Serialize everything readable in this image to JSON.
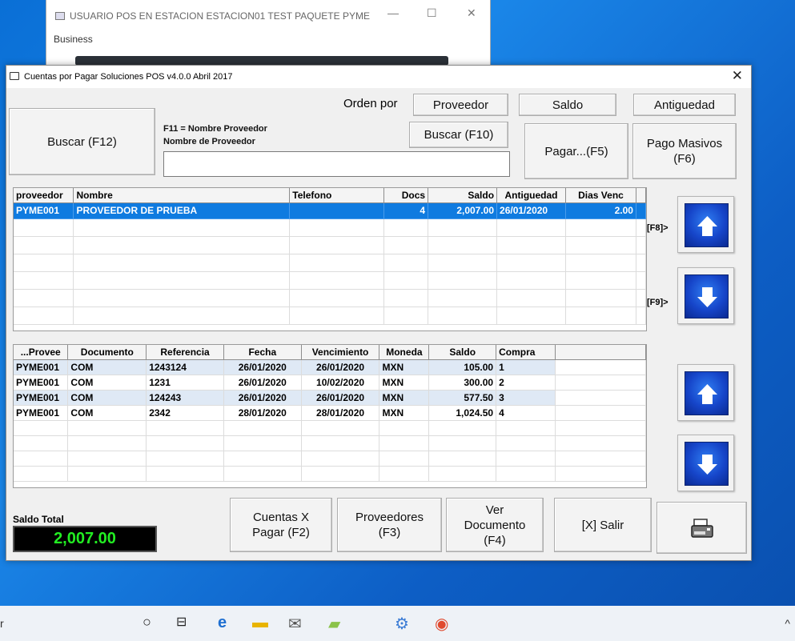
{
  "bg_window": {
    "title": "USUARIO POS EN ESTACION ESTACION01    TEST PAQUETE PYME",
    "minimize": "—",
    "maximize": "☐",
    "close": "✕",
    "menu": "Business"
  },
  "dialog": {
    "title": "Cuentas por Pagar Soluciones POS v4.0.0 Abril 2017",
    "close": "✕"
  },
  "toolbar": {
    "buscar_f12": "Buscar (F12)",
    "f11_label": "F11 = Nombre Proveedor",
    "search_caption": "Nombre de Proveedor",
    "search_value": "",
    "orden_por": "Orden por",
    "proveedor": "Proveedor",
    "saldo": "Saldo",
    "antiguedad": "Antiguedad",
    "buscar_f10": "Buscar (F10)",
    "pagar_f5": "Pagar...(F5)",
    "pago_masivos": "Pago Masivos\n(F6)"
  },
  "suppliers_grid": {
    "columns": [
      "proveedor",
      "Nombre",
      "Telefono",
      "Docs",
      "Saldo",
      "Antiguedad",
      "Dias Venc"
    ],
    "rows": [
      [
        "PYME001",
        "PROVEEDOR DE PRUEBA",
        "",
        "4",
        "2,007.00",
        "26/01/2020",
        "2.00"
      ]
    ]
  },
  "docs_grid": {
    "columns": [
      "...Provee",
      "Documento",
      "Referencia",
      "Fecha",
      "Vencimiento",
      "Moneda",
      "Saldo",
      "Compra"
    ],
    "rows": [
      [
        "PYME001",
        "COM",
        "1243124",
        "26/01/2020",
        "26/01/2020",
        "MXN",
        "105.00",
        "1"
      ],
      [
        "PYME001",
        "COM",
        "1231",
        "26/01/2020",
        "10/02/2020",
        "MXN",
        "300.00",
        "2"
      ],
      [
        "PYME001",
        "COM",
        "124243",
        "26/01/2020",
        "26/01/2020",
        "MXN",
        "577.50",
        "3"
      ],
      [
        "PYME001",
        "COM",
        "2342",
        "28/01/2020",
        "28/01/2020",
        "MXN",
        "1,024.50",
        "4"
      ]
    ]
  },
  "side_keys": {
    "f8": "[F8]>",
    "f9": "[F9]>"
  },
  "footer": {
    "saldo_total_label": "Saldo Total",
    "saldo_total_value": "2,007.00",
    "cuentas_x_pagar": "Cuentas X\nPagar (F2)",
    "proveedores": "Proveedores\n(F3)",
    "ver_documento": "Ver\nDocumento\n(F4)",
    "salir": "[X] Salir"
  },
  "taskbar": {
    "search_fragment": "r",
    "tray": "^"
  },
  "colors": {
    "selection": "#0f7be0",
    "alt_row": "#dfe9f5",
    "saldo_text": "#22ee22",
    "arrow_blue": "#1645c9"
  }
}
